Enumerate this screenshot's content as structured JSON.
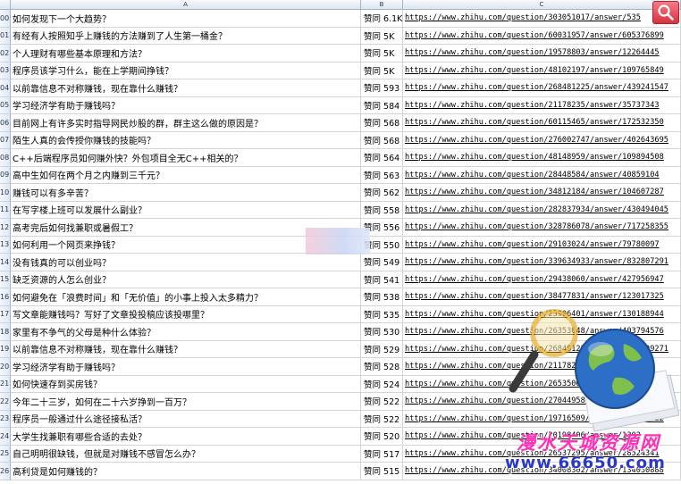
{
  "columns": [
    "A",
    "B",
    "C"
  ],
  "rows": [
    {
      "num": "00",
      "title": "如何发现下一个大趋势？",
      "votes": "赞同 6.1K",
      "url": "https://www.zhihu.com/question/303051017/answer/535"
    },
    {
      "num": "01",
      "title": "有经有人按照知乎上赚钱的方法赚到了人生第一桶金？",
      "votes": "赞同 5K",
      "url": "https://www.zhihu.com/question/60031957/answer/605376899"
    },
    {
      "num": "02",
      "title": "个人理财有哪些基本原理和方法？",
      "votes": "赞同 5K",
      "url": "https://www.zhihu.com/question/19578803/answer/12264445"
    },
    {
      "num": "03",
      "title": "程序员该学习什么，能在上学期间挣钱？",
      "votes": "赞同 5K",
      "url": "https://www.zhihu.com/question/48102197/answer/109765849"
    },
    {
      "num": "04",
      "title": "以前靠信息不对称赚钱，现在靠什么赚钱？",
      "votes": "赞同 593",
      "url": "https://www.zhihu.com/question/268481225/answer/439241547"
    },
    {
      "num": "05",
      "title": "学习经济学有助于赚钱吗？",
      "votes": "赞同 584",
      "url": "https://www.zhihu.com/question/21178235/answer/35737343"
    },
    {
      "num": "06",
      "title": "目前网上有许多实时指导网民炒股的群，群主这么做的原因是？",
      "votes": "赞同 568",
      "url": "https://www.zhihu.com/question/60115465/answer/172532350"
    },
    {
      "num": "07",
      "title": "陌生人真的会传授你赚钱的技能吗？",
      "votes": "赞同 568",
      "url": "https://www.zhihu.com/question/276002747/answer/402643695"
    },
    {
      "num": "08",
      "title": "C++后端程序员如何赚外快？外包项目全无C++相关的？",
      "votes": "赞同 564",
      "url": "https://www.zhihu.com/question/48148959/answer/109894508"
    },
    {
      "num": "09",
      "title": "高中生如何在两个月之内赚到三千元？",
      "votes": "赞同 563",
      "url": "https://www.zhihu.com/question/28448584/answer/40859104"
    },
    {
      "num": "10",
      "title": "赚钱可以有多辛苦？",
      "votes": "赞同 562",
      "url": "https://www.zhihu.com/question/34812184/answer/104607287"
    },
    {
      "num": "11",
      "title": "在写字楼上班可以发展什么副业？",
      "votes": "赞同 558",
      "url": "https://www.zhihu.com/question/282837934/answer/430494045"
    },
    {
      "num": "12",
      "title": "高考完后如何找兼职或暑假工？",
      "votes": "赞同 556",
      "url": "https://www.zhihu.com/question/328786078/answer/717258355"
    },
    {
      "num": "13",
      "title": "如何利用一个网页来挣钱？",
      "votes": "赞同 550",
      "url": "https://www.zhihu.com/question/29103024/answer/79780097"
    },
    {
      "num": "14",
      "title": "没有钱真的可以创业吗？",
      "votes": "赞同 549",
      "url": "https://www.zhihu.com/question/339634933/answer/832807291"
    },
    {
      "num": "15",
      "title": "缺乏资源的人怎么创业？",
      "votes": "赞同 541",
      "url": "https://www.zhihu.com/question/29438060/answer/427956947"
    },
    {
      "num": "16",
      "title": "如何避免在「浪费时间」和「无价值」的小事上投入太多精力？",
      "votes": "赞同 538",
      "url": "https://www.zhihu.com/question/38477831/answer/123017325"
    },
    {
      "num": "17",
      "title": "写文章能赚钱吗？写好了文章投投稿应该投哪里？",
      "votes": "赞同 535",
      "url": "https://www.zhihu.com/question/25906401/answer/130188944"
    },
    {
      "num": "18",
      "title": "家里有不争气的父母是种什么体验？",
      "votes": "赞同 530",
      "url": "https://www.zhihu.com/question/26353048/answer/403794576"
    },
    {
      "num": "19",
      "title": "以前靠信息不对称赚钱，现在靠什么赚钱？",
      "votes": "赞同 529",
      "url": "https://www.zhihu.com/question/268481225/answer/415309271"
    },
    {
      "num": "20",
      "title": "学习经济学有助于赚钱吗？",
      "votes": "赞同 528",
      "url": "https://www.zhihu.com/question/21178235/answer/1218"
    },
    {
      "num": "21",
      "title": "如何快速存到买房钱？",
      "votes": "赞同 524",
      "url": "https://www.zhihu.com/question/26535066/answer/5983"
    },
    {
      "num": "22",
      "title": "今年二十三岁，如何在二十六岁挣到一百万？",
      "votes": "赞同 522",
      "url": "https://www.zhihu.com/question/27044958/answer/364141372"
    },
    {
      "num": "23",
      "title": "程序员一般通过什么途径接私活？",
      "votes": "赞同 522",
      "url": "https://www.zhihu.com/question/19716509/answer/112297422"
    },
    {
      "num": "24",
      "title": "大学生找兼职有哪些合适的去处？",
      "votes": "赞同 520",
      "url": "https://www.zhihu.com/question/20198406/answer/1302"
    },
    {
      "num": "25",
      "title": "自己明明很缺钱，但就是对赚钱不感冒怎么办？",
      "votes": "赞同 517",
      "url": "https://www.zhihu.com/question/26537295/answer/28524341"
    },
    {
      "num": "26",
      "title": "高利贷是如何赚钱的？",
      "votes": "赞同 515",
      "url": "https://www.zhihu.com/question/34008302/answer/134030888"
    }
  ],
  "watermark": {
    "brand_text": "漫水天城资源网",
    "url_text": "www.66650.com"
  },
  "colors": {
    "header_bg": "#dde5ef",
    "gridline": "#d4d4d4",
    "search_button": "#d8323f",
    "watermark_pink": "#ff2fb6",
    "watermark_blue": "#2c39c7"
  }
}
